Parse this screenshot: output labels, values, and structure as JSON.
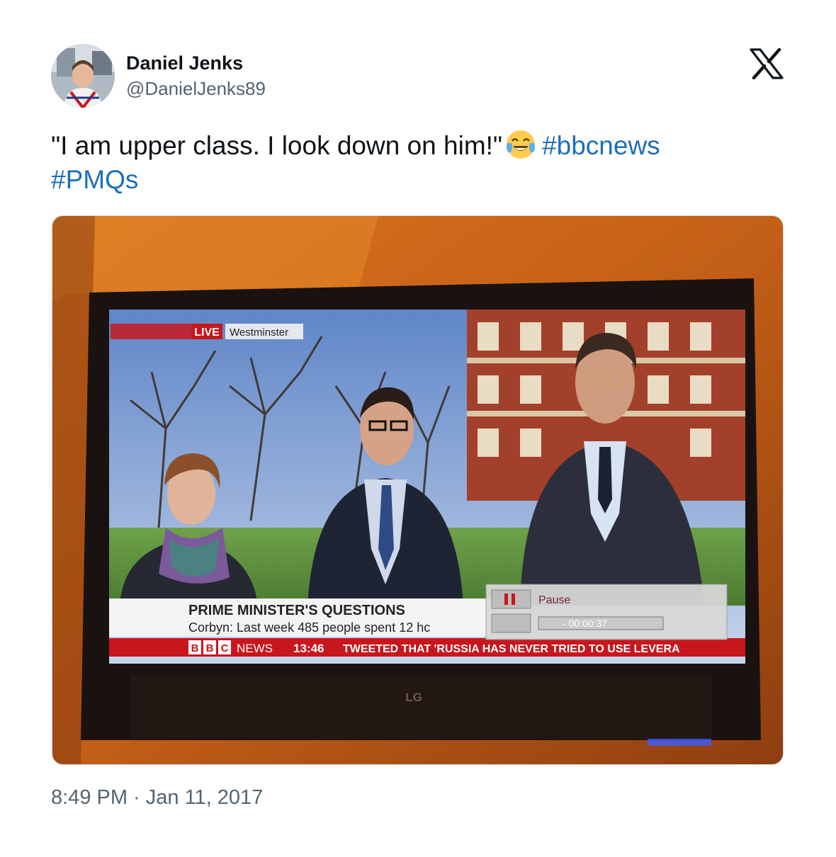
{
  "tweet": {
    "display_name": "Daniel Jenks",
    "handle": "@DanielJenks89",
    "text": "\"I am upper class. I look down on him!\"",
    "emoji": "face-with-tears-of-joy",
    "hashtags": [
      "#bbcnews",
      "#PMQs"
    ],
    "timestamp": "8:49 PM · Jan 11, 2017"
  },
  "tv_screen": {
    "live_badge": "LIVE",
    "location": "Westminster",
    "headline": "PRIME MINISTER'S QUESTIONS",
    "subline": "Corbyn: Last week 485 people spent 12 hc",
    "channel": "NEWS",
    "bbc_letters": [
      "B",
      "B",
      "C"
    ],
    "clock": "13:46",
    "ticker": "TWEETED THAT 'RUSSIA HAS NEVER TRIED TO USE LEVERA",
    "pause_label": "Pause",
    "pause_time": "- 00:00:37",
    "tv_brand": "LG"
  },
  "colors": {
    "hashtag": "#1d6fb8",
    "bbc_red": "#c8161d",
    "wall": "#c4651c"
  }
}
